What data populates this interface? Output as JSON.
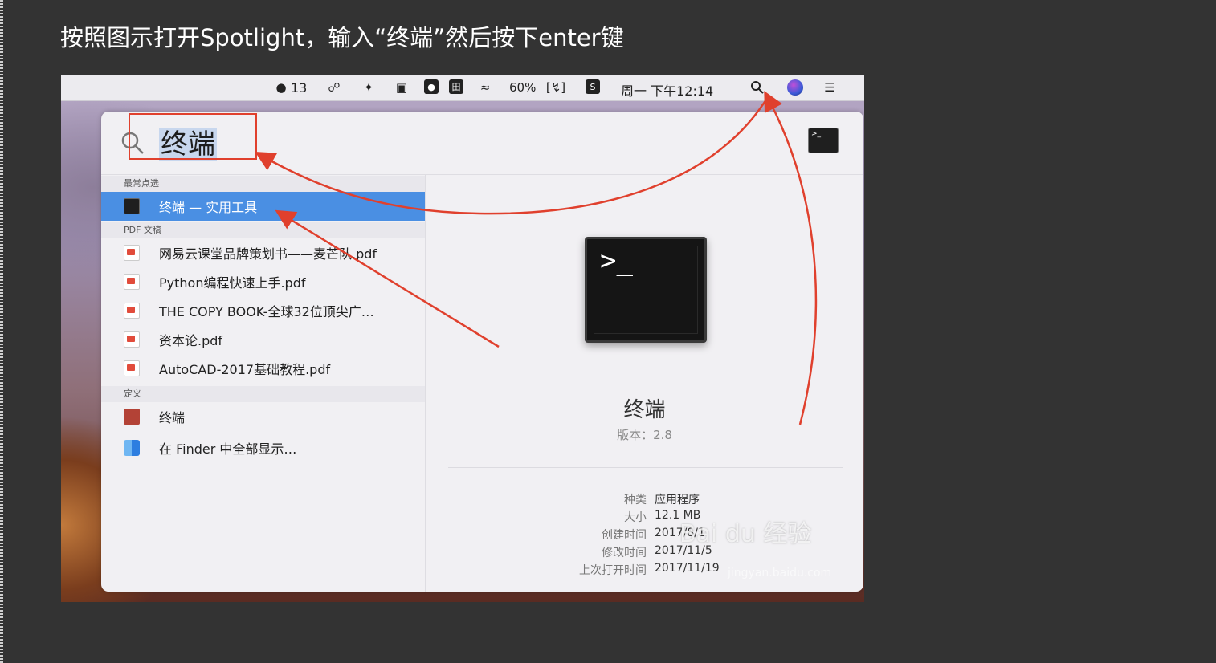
{
  "instruction": "按照图示打开Spotlight，输入“终端”然后按下enter键",
  "menubar": {
    "qq_count": "13",
    "battery": "60%",
    "clock": "周一 下午12:14"
  },
  "spotlight": {
    "query": "终端",
    "sections": {
      "top_hit": "最常点选",
      "pdf": "PDF 文稿",
      "definition": "定义"
    },
    "top_hit": {
      "label": "终端 — 实用工具"
    },
    "pdf_items": [
      {
        "label": "网易云课堂品牌策划书——麦芒队.pdf"
      },
      {
        "label": "Python编程快速上手.pdf"
      },
      {
        "label": "THE COPY BOOK-全球32位顶尖广…"
      },
      {
        "label": "资本论.pdf"
      },
      {
        "label": "AutoCAD-2017基础教程.pdf"
      }
    ],
    "definition_item": {
      "label": "终端"
    },
    "finder_item": {
      "label": "在 Finder 中全部显示…"
    }
  },
  "preview": {
    "prompt": ">_",
    "app_name": "终端",
    "version": "版本：2.8",
    "details": [
      {
        "key": "种类",
        "value": "应用程序"
      },
      {
        "key": "大小",
        "value": "12.1 MB"
      },
      {
        "key": "创建时间",
        "value": "2017/8/1"
      },
      {
        "key": "修改时间",
        "value": "2017/11/5"
      },
      {
        "key": "上次打开时间",
        "value": "2017/11/19"
      }
    ]
  },
  "watermark": {
    "text": "Bai du 经验",
    "sub": "jingyan.baidu.com"
  },
  "colors": {
    "accent_selection": "#4a8fe3",
    "annotation_red": "#e0402d",
    "page_bg": "#333333"
  }
}
